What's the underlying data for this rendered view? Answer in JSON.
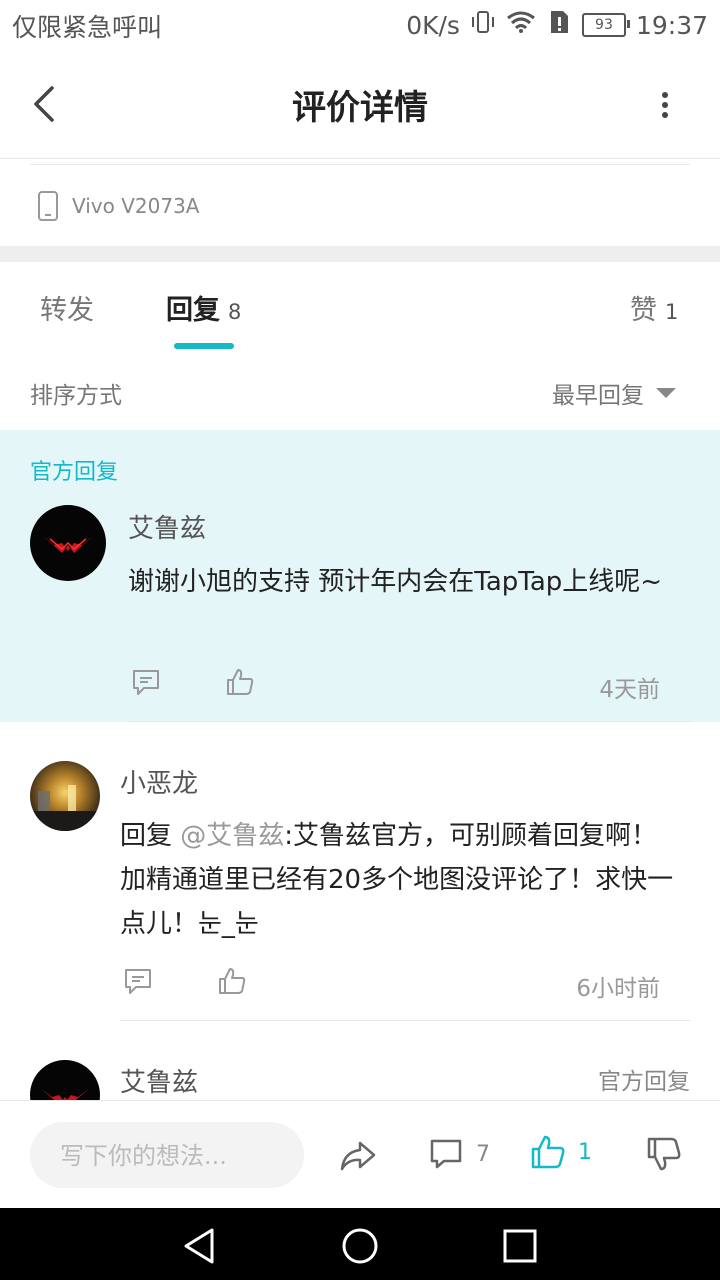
{
  "status_bar": {
    "carrier": "仅限紧急呼叫",
    "network_speed": "0K/s",
    "battery": "93",
    "time": "19:37"
  },
  "header": {
    "title": "评价详情"
  },
  "device": {
    "name": "Vivo V2073A"
  },
  "tabs": {
    "forward": {
      "label": "转发"
    },
    "reply": {
      "label": "回复",
      "count": "8"
    },
    "like": {
      "label": "赞",
      "count": "1"
    }
  },
  "sort": {
    "label": "排序方式",
    "value": "最早回复"
  },
  "official_section": {
    "tag": "官方回复",
    "author": "艾鲁兹",
    "content": "谢谢小旭的支持 预计年内会在TapTap上线呢~",
    "time": "4天前"
  },
  "replies": [
    {
      "author": "小恶龙",
      "reply_prefix": "回复",
      "mention": "@艾鲁兹",
      "content": ":艾鲁兹官方，可别顾着回复啊！加精通道里已经有20多个地图没评论了！求快一点儿！눈_눈",
      "time": "6小时前"
    },
    {
      "author": "艾鲁兹",
      "badge": "官方回复"
    }
  ],
  "bottom_bar": {
    "input_placeholder": "写下你的想法...",
    "comment_count": "7",
    "like_count": "1"
  },
  "colors": {
    "accent": "#14b9c8",
    "official_bg": "#e5f6f9"
  }
}
